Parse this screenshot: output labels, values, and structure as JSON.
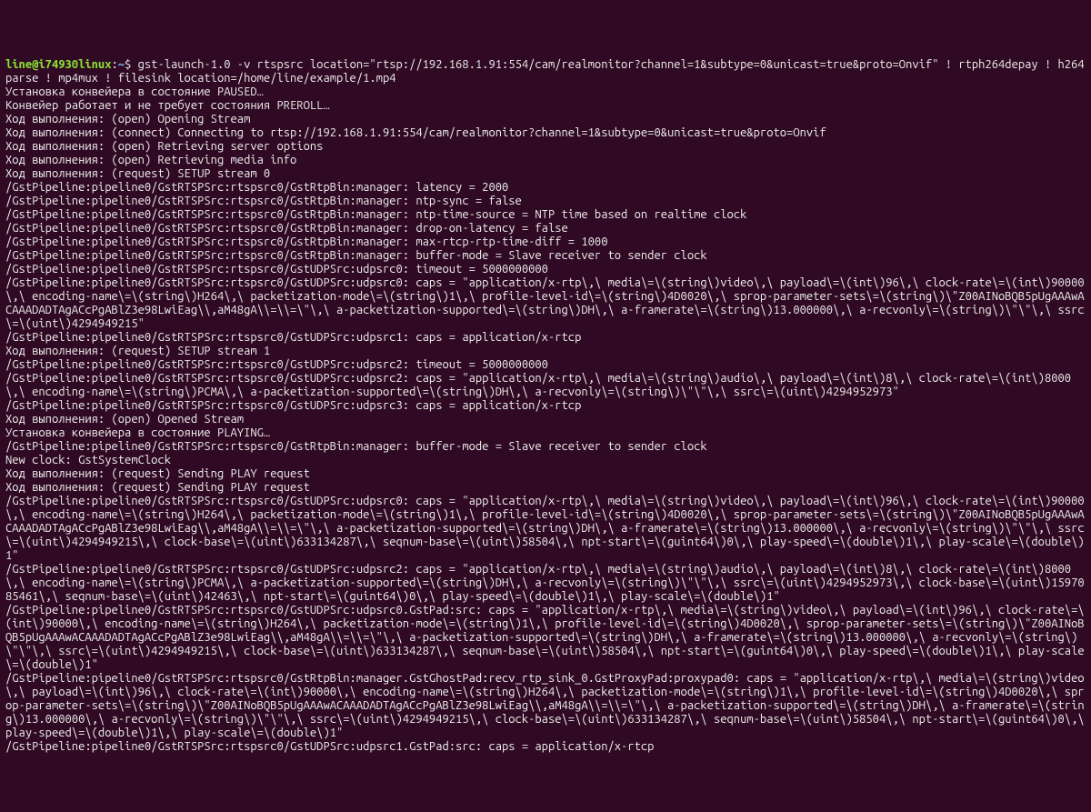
{
  "prompt": {
    "user_host": "line@i74930linux",
    "colon": ":",
    "path": "~",
    "dollar": "$ "
  },
  "command": "gst-launch-1.0 -v rtspsrc location=\"rtsp://192.168.1.91:554/cam/realmonitor?channel=1&subtype=0&unicast=true&proto=Onvif\" ! rtph264depay ! h264parse ! mp4mux ! filesink location=/home/line/example/1.mp4",
  "output": [
    "Установка конвейера в состояние PAUSED…",
    "Конвейер работает и не требует состояния PREROLL…",
    "Ход выполнения: (open) Opening Stream",
    "Ход выполнения: (connect) Connecting to rtsp://192.168.1.91:554/cam/realmonitor?channel=1&subtype=0&unicast=true&proto=Onvif",
    "Ход выполнения: (open) Retrieving server options",
    "Ход выполнения: (open) Retrieving media info",
    "Ход выполнения: (request) SETUP stream 0",
    "/GstPipeline:pipeline0/GstRTSPSrc:rtspsrc0/GstRtpBin:manager: latency = 2000",
    "/GstPipeline:pipeline0/GstRTSPSrc:rtspsrc0/GstRtpBin:manager: ntp-sync = false",
    "/GstPipeline:pipeline0/GstRTSPSrc:rtspsrc0/GstRtpBin:manager: ntp-time-source = NTP time based on realtime clock",
    "/GstPipeline:pipeline0/GstRTSPSrc:rtspsrc0/GstRtpBin:manager: drop-on-latency = false",
    "/GstPipeline:pipeline0/GstRTSPSrc:rtspsrc0/GstRtpBin:manager: max-rtcp-rtp-time-diff = 1000",
    "/GstPipeline:pipeline0/GstRTSPSrc:rtspsrc0/GstRtpBin:manager: buffer-mode = Slave receiver to sender clock",
    "/GstPipeline:pipeline0/GstRTSPSrc:rtspsrc0/GstUDPSrc:udpsrc0: timeout = 5000000000",
    "/GstPipeline:pipeline0/GstRTSPSrc:rtspsrc0/GstUDPSrc:udpsrc0: caps = \"application/x-rtp\\,\\ media\\=\\(string\\)video\\,\\ payload\\=\\(int\\)96\\,\\ clock-rate\\=\\(int\\)90000\\,\\ encoding-name\\=\\(string\\)H264\\,\\ packetization-mode\\=\\(string\\)1\\,\\ profile-level-id\\=\\(string\\)4D0020\\,\\ sprop-parameter-sets\\=\\(string\\)\\\"Z00AINoBQB5pUgAAAwACAAADADTAgACcPgABlZ3e98LwiEag\\\\,aM48gA\\\\=\\\\=\\\"\\,\\ a-packetization-supported\\=\\(string\\)DH\\,\\ a-framerate\\=\\(string\\)13.000000\\,\\ a-recvonly\\=\\(string\\)\\\"\\\"\\,\\ ssrc\\=\\(uint\\)4294949215\"",
    "/GstPipeline:pipeline0/GstRTSPSrc:rtspsrc0/GstUDPSrc:udpsrc1: caps = application/x-rtcp",
    "Ход выполнения: (request) SETUP stream 1",
    "/GstPipeline:pipeline0/GstRTSPSrc:rtspsrc0/GstUDPSrc:udpsrc2: timeout = 5000000000",
    "/GstPipeline:pipeline0/GstRTSPSrc:rtspsrc0/GstUDPSrc:udpsrc2: caps = \"application/x-rtp\\,\\ media\\=\\(string\\)audio\\,\\ payload\\=\\(int\\)8\\,\\ clock-rate\\=\\(int\\)8000\\,\\ encoding-name\\=\\(string\\)PCMA\\,\\ a-packetization-supported\\=\\(string\\)DH\\,\\ a-recvonly\\=\\(string\\)\\\"\\\"\\,\\ ssrc\\=\\(uint\\)4294952973\"",
    "/GstPipeline:pipeline0/GstRTSPSrc:rtspsrc0/GstUDPSrc:udpsrc3: caps = application/x-rtcp",
    "Ход выполнения: (open) Opened Stream",
    "Установка конвейера в состояние PLAYING…",
    "/GstPipeline:pipeline0/GstRTSPSrc:rtspsrc0/GstRtpBin:manager: buffer-mode = Slave receiver to sender clock",
    "New clock: GstSystemClock",
    "Ход выполнения: (request) Sending PLAY request",
    "Ход выполнения: (request) Sending PLAY request",
    "/GstPipeline:pipeline0/GstRTSPSrc:rtspsrc0/GstUDPSrc:udpsrc0: caps = \"application/x-rtp\\,\\ media\\=\\(string\\)video\\,\\ payload\\=\\(int\\)96\\,\\ clock-rate\\=\\(int\\)90000\\,\\ encoding-name\\=\\(string\\)H264\\,\\ packetization-mode\\=\\(string\\)1\\,\\ profile-level-id\\=\\(string\\)4D0020\\,\\ sprop-parameter-sets\\=\\(string\\)\\\"Z00AINoBQB5pUgAAAwACAAADADTAgACcPgABlZ3e98LwiEag\\\\,aM48gA\\\\=\\\\=\\\"\\,\\ a-packetization-supported\\=\\(string\\)DH\\,\\ a-framerate\\=\\(string\\)13.000000\\,\\ a-recvonly\\=\\(string\\)\\\"\\\"\\,\\ ssrc\\=\\(uint\\)4294949215\\,\\ clock-base\\=\\(uint\\)633134287\\,\\ seqnum-base\\=\\(uint\\)58504\\,\\ npt-start\\=\\(guint64\\)0\\,\\ play-speed\\=\\(double\\)1\\,\\ play-scale\\=\\(double\\)1\"",
    "/GstPipeline:pipeline0/GstRTSPSrc:rtspsrc0/GstUDPSrc:udpsrc2: caps = \"application/x-rtp\\,\\ media\\=\\(string\\)audio\\,\\ payload\\=\\(int\\)8\\,\\ clock-rate\\=\\(int\\)8000\\,\\ encoding-name\\=\\(string\\)PCMA\\,\\ a-packetization-supported\\=\\(string\\)DH\\,\\ a-recvonly\\=\\(string\\)\\\"\\\"\\,\\ ssrc\\=\\(uint\\)4294952973\\,\\ clock-base\\=\\(uint\\)1597085461\\,\\ seqnum-base\\=\\(uint\\)42463\\,\\ npt-start\\=\\(guint64\\)0\\,\\ play-speed\\=\\(double\\)1\\,\\ play-scale\\=\\(double\\)1\"",
    "/GstPipeline:pipeline0/GstRTSPSrc:rtspsrc0/GstUDPSrc:udpsrc0.GstPad:src: caps = \"application/x-rtp\\,\\ media\\=\\(string\\)video\\,\\ payload\\=\\(int\\)96\\,\\ clock-rate\\=\\(int\\)90000\\,\\ encoding-name\\=\\(string\\)H264\\,\\ packetization-mode\\=\\(string\\)1\\,\\ profile-level-id\\=\\(string\\)4D0020\\,\\ sprop-parameter-sets\\=\\(string\\)\\\"Z00AINoBQB5pUgAAAwACAAADADTAgACcPgABlZ3e98LwiEag\\\\,aM48gA\\\\=\\\\=\\\"\\,\\ a-packetization-supported\\=\\(string\\)DH\\,\\ a-framerate\\=\\(string\\)13.000000\\,\\ a-recvonly\\=\\(string\\)\\\"\\\"\\,\\ ssrc\\=\\(uint\\)4294949215\\,\\ clock-base\\=\\(uint\\)633134287\\,\\ seqnum-base\\=\\(uint\\)58504\\,\\ npt-start\\=\\(guint64\\)0\\,\\ play-speed\\=\\(double\\)1\\,\\ play-scale\\=\\(double\\)1\"",
    "/GstPipeline:pipeline0/GstRTSPSrc:rtspsrc0/GstRtpBin:manager.GstGhostPad:recv_rtp_sink_0.GstProxyPad:proxypad0: caps = \"application/x-rtp\\,\\ media\\=\\(string\\)video\\,\\ payload\\=\\(int\\)96\\,\\ clock-rate\\=\\(int\\)90000\\,\\ encoding-name\\=\\(string\\)H264\\,\\ packetization-mode\\=\\(string\\)1\\,\\ profile-level-id\\=\\(string\\)4D0020\\,\\ sprop-parameter-sets\\=\\(string\\)\\\"Z00AINoBQB5pUgAAAwACAAADADTAgACcPgABlZ3e98LwiEag\\\\,aM48gA\\\\=\\\\=\\\"\\,\\ a-packetization-supported\\=\\(string\\)DH\\,\\ a-framerate\\=\\(string\\)13.000000\\,\\ a-recvonly\\=\\(string\\)\\\"\\\"\\,\\ ssrc\\=\\(uint\\)4294949215\\,\\ clock-base\\=\\(uint\\)633134287\\,\\ seqnum-base\\=\\(uint\\)58504\\,\\ npt-start\\=\\(guint64\\)0\\,\\ play-speed\\=\\(double\\)1\\,\\ play-scale\\=\\(double\\)1\"",
    "/GstPipeline:pipeline0/GstRTSPSrc:rtspsrc0/GstUDPSrc:udpsrc1.GstPad:src: caps = application/x-rtcp"
  ]
}
